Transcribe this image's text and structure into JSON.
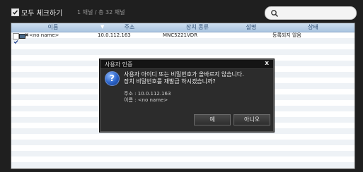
{
  "toolbar": {
    "select_all_label": "모두 체크하기",
    "count_text": "1 채널 / 총 32 채널",
    "search_icon": "search-icon"
  },
  "table": {
    "columns": [
      "이름",
      "주소",
      "장치 종류",
      "설명",
      "상태"
    ],
    "rows": [
      {
        "name": "<no name>",
        "address": "10.0.112.163",
        "device_type": "MNC5221VDR",
        "description": "",
        "status": "등록되지 않음",
        "checked": true
      }
    ]
  },
  "dialog": {
    "title": "사용자 인증",
    "close_label": "x",
    "message_line1": "사용자 아이디 또는 비밀번호가 올바르지 않습니다.",
    "message_line2": "장치 비밀번호를 재발급 하시겠습니까?",
    "address_line": "주소 : 10.0.112.163",
    "name_line": "이름 : <no name>",
    "yes_label": "예",
    "no_label": "아니오",
    "icon": "question-icon"
  }
}
